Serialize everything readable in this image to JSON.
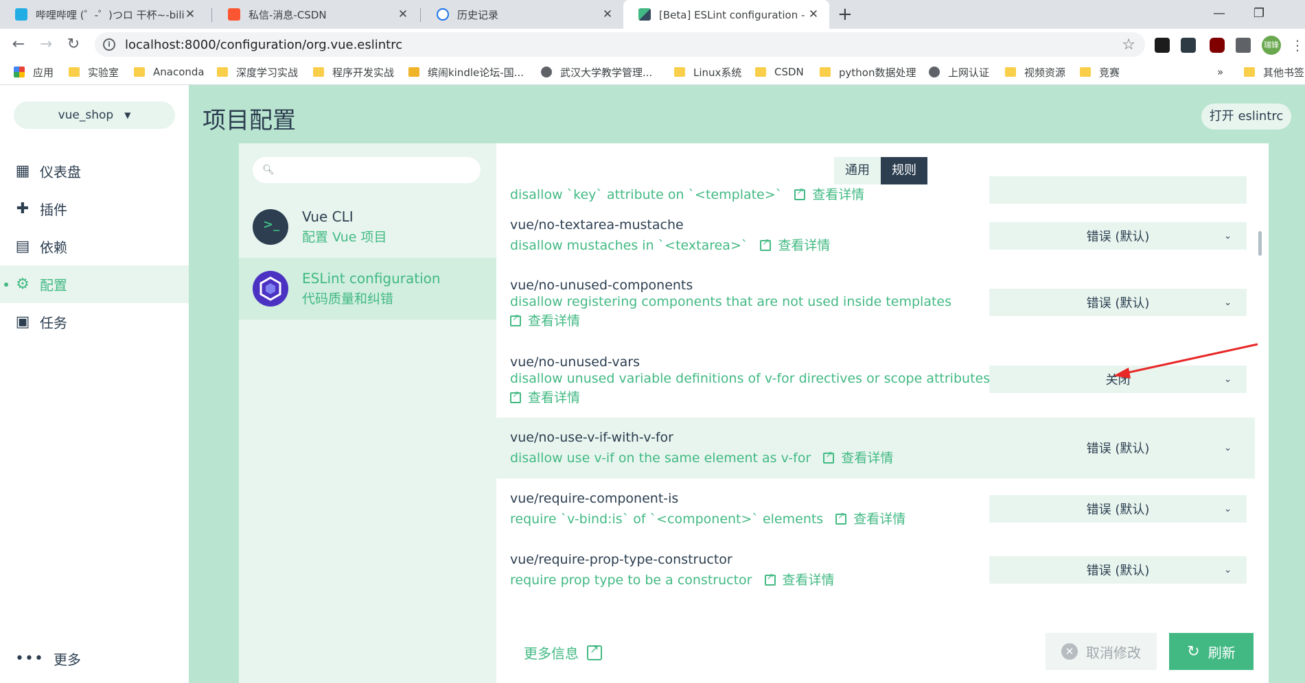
{
  "browser": {
    "tabs": [
      {
        "title": "哔哩哔哩 (゜-゜)つロ 干杯~-bili",
        "active": false
      },
      {
        "title": "私信-消息-CSDN",
        "active": false
      },
      {
        "title": "历史记录",
        "active": false
      },
      {
        "title": "[Beta] ESLint configuration - 项",
        "active": true
      }
    ],
    "url": "localhost:8000/configuration/org.vue.eslintrc",
    "profile_label": "瑞锋",
    "bookmarks": [
      "应用",
      "实验室",
      "Anaconda",
      "深度学习实战",
      "程序开发实战",
      "缤闹kindle论坛-国...",
      "武汉大学教学管理...",
      "Linux系统",
      "CSDN",
      "python数据处理",
      "上网认证",
      "视频资源",
      "竞赛"
    ],
    "bookmarks_overflow": "»",
    "other_bookmarks": "其他书签"
  },
  "sidebar": {
    "project": "vue_shop",
    "items": [
      {
        "label": "仪表盘",
        "icon": "dashboard-icon"
      },
      {
        "label": "插件",
        "icon": "puzzle-icon"
      },
      {
        "label": "依赖",
        "icon": "book-icon"
      },
      {
        "label": "配置",
        "icon": "settings-icon"
      },
      {
        "label": "任务",
        "icon": "clipboard-icon"
      }
    ],
    "more": "更多"
  },
  "main": {
    "title": "项目配置",
    "open_button": "打开 eslintrc",
    "configs": [
      {
        "title": "Vue CLI",
        "subtitle": "配置 Vue 项目"
      },
      {
        "title": "ESLint configuration",
        "subtitle": "代码质量和纠错"
      }
    ],
    "tabs": [
      "通用",
      "规则"
    ],
    "details_link": "查看详情",
    "rules": [
      {
        "name": "",
        "desc": "disallow `key` attribute on `<template>`",
        "value": ""
      },
      {
        "name": "vue/no-textarea-mustache",
        "desc": "disallow mustaches in `<textarea>`",
        "value": "错误 (默认)"
      },
      {
        "name": "vue/no-unused-components",
        "desc": "disallow registering components that are not used inside templates",
        "value": "错误 (默认)"
      },
      {
        "name": "vue/no-unused-vars",
        "desc": "disallow unused variable definitions of v-for directives or scope attributes",
        "value": "关闭"
      },
      {
        "name": "vue/no-use-v-if-with-v-for",
        "desc": "disallow use v-if on the same element as v-for",
        "value": "错误 (默认)"
      },
      {
        "name": "vue/require-component-is",
        "desc": "require `v-bind:is` of `<component>` elements",
        "value": "错误 (默认)"
      },
      {
        "name": "vue/require-prop-type-constructor",
        "desc": "require prop type to be a constructor",
        "value": "错误 (默认)"
      }
    ],
    "footer": {
      "more_info": "更多信息",
      "cancel": "取消修改",
      "refresh": "刷新"
    }
  },
  "colors": {
    "accent": "#42b983",
    "dark": "#2c3e50",
    "bg": "#b9e4d0",
    "light": "#e8f5ee",
    "annotation": "#e82727"
  }
}
